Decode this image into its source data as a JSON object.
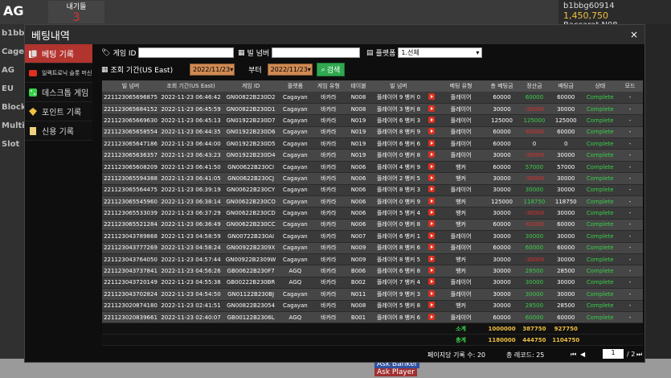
{
  "background": {
    "logo": "AG",
    "top_box_label": "내기들",
    "top_box_value": "3",
    "left_labels": [
      "b1bb",
      "Cage",
      "AG",
      "EU",
      "Block",
      "Multi",
      "Slot"
    ],
    "user": "b1bbg60914",
    "balance": "1,450,750",
    "table_name": "Baccarat N08",
    "ask_banker": "Ask Banker",
    "ask_player": "Ask Player"
  },
  "modal": {
    "title": "베팅내역",
    "close": "×"
  },
  "sidebar": {
    "items": [
      {
        "label": "베팅 기록",
        "active": true
      },
      {
        "label": "일렉트로닉 슬롯 머신",
        "active": false
      },
      {
        "label": "데스크톱 게임",
        "active": false
      },
      {
        "label": "포인트 기록",
        "active": false
      },
      {
        "label": "신용 기록",
        "active": false
      }
    ]
  },
  "filters": {
    "game_id_label": "게임 ID",
    "bill_no_label": "빌 넘버",
    "platform_label": "플랫폼",
    "platform_value": "1.선체",
    "period_label": "조회 기간(US East)",
    "start_date": "2022/11/23",
    "to_label": "부터",
    "end_date": "2022/11/23",
    "search_label": "검색"
  },
  "table": {
    "headers": [
      "빌 넘버",
      "조회 기간(US East)",
      "게임 ID",
      "플랫폼",
      "게임 유형",
      "테이블",
      "빌 넘버",
      "",
      "베팅 유형",
      "총 베팅금",
      "정산금",
      "배팅금",
      "상태",
      "모드"
    ],
    "rows": [
      [
        "221123065696875",
        "2022-11-23 06:46:42",
        "GN00822B230D2",
        "Cagayan",
        "바카라",
        "N008",
        "플레이어 9 뱅커 0",
        "플레이어",
        "60000",
        "60000",
        "60000",
        "Complete",
        "-"
      ],
      [
        "221123065684152",
        "2022-11-23 06:45:59",
        "GN00822B230D1",
        "Cagayan",
        "바카라",
        "N008",
        "플레이어 3 뱅커 8",
        "플레이어",
        "30000",
        "-30000",
        "30000",
        "Complete",
        "-"
      ],
      [
        "221123065669630",
        "2022-11-23 06:45:13",
        "GN01922B230D7",
        "Cagayan",
        "바카라",
        "N019",
        "플레이어 6 뱅커 3",
        "플레이어",
        "125000",
        "125000",
        "125000",
        "Complete",
        "-"
      ],
      [
        "221123065658554",
        "2022-11-23 06:44:35",
        "GN01922B230D6",
        "Cagayan",
        "바카라",
        "N019",
        "플레이어 8 뱅커 9",
        "플레이어",
        "60000",
        "-60000",
        "60000",
        "Complete",
        "-"
      ],
      [
        "221123065647186",
        "2022-11-23 06:44:00",
        "GN01922B230D5",
        "Cagayan",
        "바카라",
        "N019",
        "플레이어 6 뱅커 6",
        "플레이어",
        "60000",
        "0",
        "0",
        "Complete",
        "-"
      ],
      [
        "221123065636357",
        "2022-11-23 06:43:23",
        "GN01922B230D4",
        "Cagayan",
        "바카라",
        "N019",
        "플레이어 0 뱅커 8",
        "플레이어",
        "30000",
        "-30000",
        "30000",
        "Complete",
        "-"
      ],
      [
        "221123065608209",
        "2022-11-23 06:41:50",
        "GN00622B230CI",
        "Cagayan",
        "바카라",
        "N006",
        "플레이어 4 뱅커 9",
        "뱅커",
        "60000",
        "57000",
        "57000",
        "Complete",
        "-"
      ],
      [
        "221123065594388",
        "2022-11-23 06:41:05",
        "GN00622B230CJ",
        "Cagayan",
        "바카라",
        "N006",
        "플레이어 2 뱅커 5",
        "뱅커",
        "30000",
        "-30000",
        "30000",
        "Complete",
        "-"
      ],
      [
        "221123065564475",
        "2022-11-23 06:39:19",
        "GN00622B230CY",
        "Cagayan",
        "바카라",
        "N006",
        "플레이어 8 뱅커 3",
        "플레이어",
        "30000",
        "30000",
        "30000",
        "Complete",
        "-"
      ],
      [
        "221123065545960",
        "2022-11-23 06:38:14",
        "GN00622B230CO",
        "Cagayan",
        "바카라",
        "N006",
        "플레이어 0 뱅커 9",
        "뱅커",
        "125000",
        "118750",
        "118750",
        "Complete",
        "-"
      ],
      [
        "221123065533039",
        "2022-11-23 06:37:29",
        "GN00622B230CD",
        "Cagayan",
        "바카라",
        "N006",
        "플레이어 5 뱅커 4",
        "뱅커",
        "30000",
        "-30000",
        "30000",
        "Complete",
        "-"
      ],
      [
        "221123065521284",
        "2022-11-23 06:36:49",
        "GN00622B230CC",
        "Cagayan",
        "바카라",
        "N006",
        "플레이어 0 뱅커 8",
        "뱅커",
        "60000",
        "-60000",
        "60000",
        "Complete",
        "-"
      ],
      [
        "221123043789868",
        "2022-11-23 04:58:59",
        "GN00722B230AI",
        "Cagayan",
        "바카라",
        "N007",
        "플레이어 6 뱅커 1",
        "플레이어",
        "30000",
        "30000",
        "30000",
        "Complete",
        "-"
      ],
      [
        "221123043777269",
        "2022-11-23 04:58:24",
        "GN00922B2309X",
        "Cagayan",
        "바카라",
        "N009",
        "플레이어 8 뱅커 6",
        "플레이어",
        "60000",
        "60000",
        "60000",
        "Complete",
        "-"
      ],
      [
        "221123043764050",
        "2022-11-23 04:57:44",
        "GN00922B2309W",
        "Cagayan",
        "바카라",
        "N009",
        "플레이어 8 뱅커 5",
        "뱅커",
        "30000",
        "-30000",
        "30000",
        "Complete",
        "-"
      ],
      [
        "221123043737841",
        "2022-11-23 04:56:26",
        "GB00622B230F7",
        "AGQ",
        "바카라",
        "B006",
        "플레이어 6 뱅커 8",
        "뱅커",
        "30000",
        "28500",
        "28500",
        "Complete",
        "-"
      ],
      [
        "221123043720149",
        "2022-11-23 04:55:38",
        "GB00222B230BR",
        "AGQ",
        "바카라",
        "B002",
        "플레이어 7 뱅커 4",
        "플레이어",
        "30000",
        "30000",
        "30000",
        "Complete",
        "-"
      ],
      [
        "221123043702824",
        "2022-11-23 04:54:50",
        "GN01122B230BJ",
        "Cagayan",
        "바카라",
        "N011",
        "플레이어 9 뱅커 3",
        "플레이어",
        "30000",
        "30000",
        "30000",
        "Complete",
        "-"
      ],
      [
        "221123020874180",
        "2022-11-23 02:41:51",
        "GN00822B23054",
        "Cagayan",
        "바카라",
        "N008",
        "플레이어 5 뱅커 8",
        "뱅커",
        "30000",
        "28500",
        "28500",
        "Complete",
        "-"
      ],
      [
        "221123020839661",
        "2022-11-23 02:40:07",
        "GB00122B2306L",
        "AGQ",
        "바카라",
        "B001",
        "플레이어 8 뱅커 6",
        "플레이어",
        "60000",
        "60000",
        "60000",
        "Complete",
        "-"
      ]
    ],
    "subtotal_label": "소계",
    "subtotal": [
      "1000000",
      "387750",
      "927750"
    ],
    "total_label": "총계",
    "total": [
      "1180000",
      "444750",
      "1104750"
    ]
  },
  "footer": {
    "per_page": "페이지당 기록 수: 20",
    "total_records": "총 레코드: 25",
    "current_page": "1",
    "total_pages": "/ 2"
  }
}
